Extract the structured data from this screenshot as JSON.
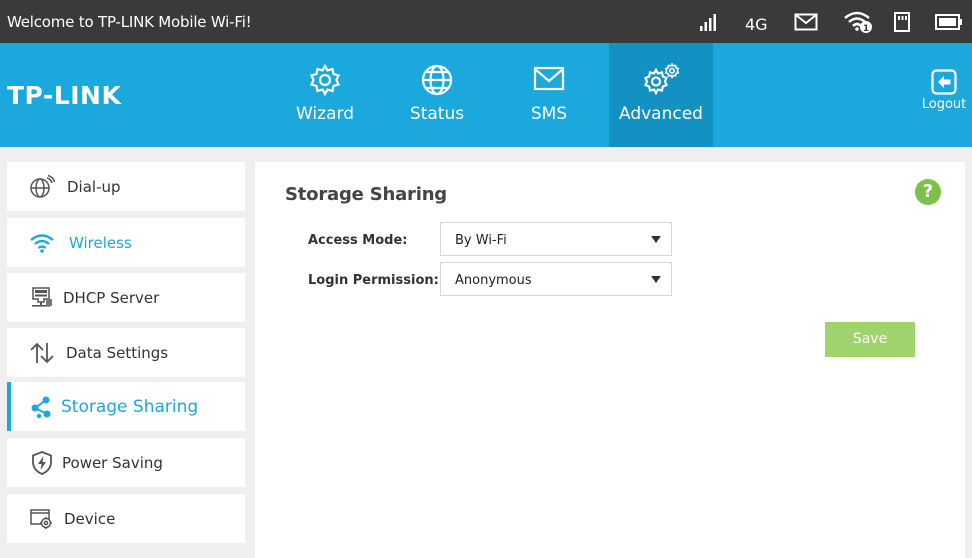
{
  "statusbar": {
    "welcome": "Welcome to TP-LINK Mobile Wi-Fi!",
    "network_type": "4G",
    "wifi_clients": "1"
  },
  "header": {
    "logo": "TP-LINK",
    "nav": [
      {
        "label": "Wizard",
        "icon": "gear-icon"
      },
      {
        "label": "Status",
        "icon": "globe-icon"
      },
      {
        "label": "SMS",
        "icon": "envelope-icon"
      },
      {
        "label": "Advanced",
        "icon": "gears-icon",
        "active": true
      }
    ],
    "logout_label": "Logout"
  },
  "sidebar": {
    "items": [
      {
        "label": "Dial-up",
        "icon": "globe-dialup-icon"
      },
      {
        "label": "Wireless",
        "icon": "wifi-icon"
      },
      {
        "label": "DHCP Server",
        "icon": "server-icon"
      },
      {
        "label": "Data Settings",
        "icon": "up-down-arrows-icon"
      },
      {
        "label": "Storage Sharing",
        "icon": "share-icon",
        "active": true
      },
      {
        "label": "Power Saving",
        "icon": "shield-bolt-icon"
      },
      {
        "label": "Device",
        "icon": "device-settings-icon"
      }
    ]
  },
  "main": {
    "title": "Storage Sharing",
    "access_mode": {
      "label": "Access Mode:",
      "value": "By Wi-Fi"
    },
    "login_permission": {
      "label": "Login Permission:",
      "value": "Anonymous"
    },
    "save_label": "Save"
  },
  "colors": {
    "accent": "#1ba8dd",
    "accent_dark": "#1391c2",
    "statusbar_bg": "#3a3a3a",
    "save_button": "#9fd46c",
    "help_button": "#7ec14a"
  }
}
